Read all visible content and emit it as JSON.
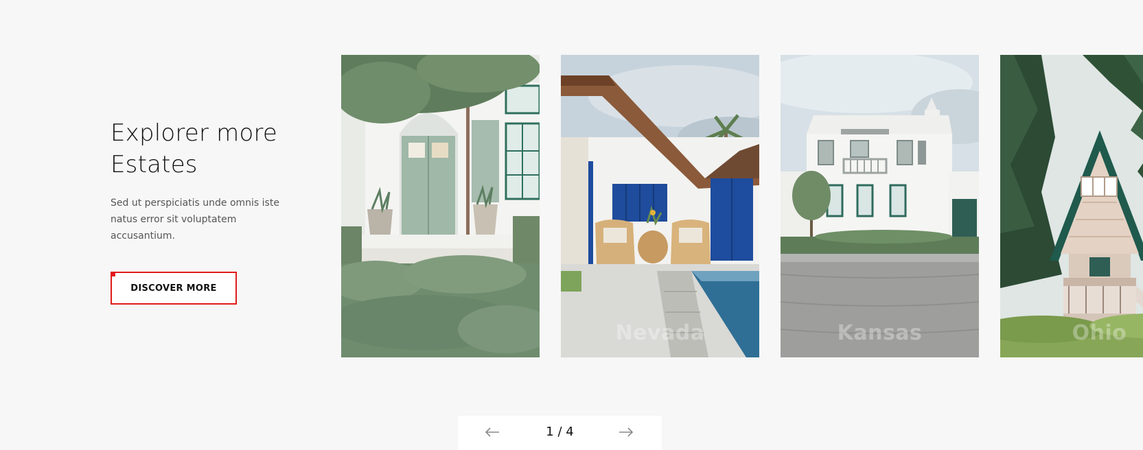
{
  "intro": {
    "title": "Explorer more Estates",
    "description": "Sed ut perspiciatis unde omnis iste natus error sit voluptatem accusantium.",
    "button_label": "DISCOVER MORE"
  },
  "cards": [
    {
      "label": ""
    },
    {
      "label": "Nevada"
    },
    {
      "label": "Kansas"
    },
    {
      "label": "Ohio"
    }
  ],
  "pager": {
    "prev_icon": "arrow-left-icon",
    "next_icon": "arrow-right-icon",
    "counter": "1 / 4"
  },
  "colors": {
    "background": "#f7f7f7",
    "accent": "#e21b1b"
  }
}
